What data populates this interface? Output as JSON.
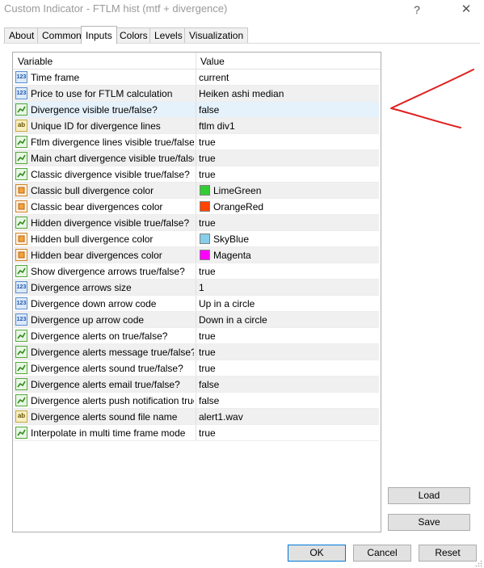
{
  "window": {
    "title": "Custom Indicator - FTLM hist (mtf + divergence)",
    "help_glyph": "?",
    "close_glyph": "✕"
  },
  "tabs": [
    {
      "label": "About"
    },
    {
      "label": "Common"
    },
    {
      "label": "Inputs",
      "active": true
    },
    {
      "label": "Colors"
    },
    {
      "label": "Levels"
    },
    {
      "label": "Visualization"
    }
  ],
  "grid": {
    "col_variable": "Variable",
    "col_value": "Value",
    "rows": [
      {
        "type": "int",
        "name": "Time frame",
        "value": "current"
      },
      {
        "type": "int",
        "name": "Price to use for FTLM calculation",
        "value": "Heiken ashi median"
      },
      {
        "type": "bool",
        "name": "Divergence visible true/false?",
        "value": "false",
        "selected": true
      },
      {
        "type": "string",
        "name": "Unique ID for divergence lines",
        "value": "ftlm div1"
      },
      {
        "type": "bool",
        "name": "Ftlm divergence lines visible true/false?",
        "value": "true"
      },
      {
        "type": "bool",
        "name": "Main chart divergence visible true/false?",
        "value": "true"
      },
      {
        "type": "bool",
        "name": "Classic divergence visible true/false?",
        "value": "true"
      },
      {
        "type": "color",
        "name": "Classic bull divergence color",
        "value": "LimeGreen",
        "color": "#32cd32"
      },
      {
        "type": "color",
        "name": "Classic bear divergences color",
        "value": "OrangeRed",
        "color": "#ff4500"
      },
      {
        "type": "bool",
        "name": "Hidden divergence visible true/false?",
        "value": "true"
      },
      {
        "type": "color",
        "name": "Hidden bull divergence color",
        "value": "SkyBlue",
        "color": "#87ceeb"
      },
      {
        "type": "color",
        "name": "Hidden bear divergences color",
        "value": "Magenta",
        "color": "#ff00ff"
      },
      {
        "type": "bool",
        "name": "Show divergence arrows true/false?",
        "value": "true"
      },
      {
        "type": "int",
        "name": "Divergence arrows size",
        "value": "1"
      },
      {
        "type": "int",
        "name": "Divergence down arrow code",
        "value": "Up in a circle"
      },
      {
        "type": "int",
        "name": "Divergence up arrow code",
        "value": "Down in a circle"
      },
      {
        "type": "bool",
        "name": "Divergence alerts on true/false?",
        "value": "true"
      },
      {
        "type": "bool",
        "name": "Divergence alerts message true/false?",
        "value": "true"
      },
      {
        "type": "bool",
        "name": "Divergence alerts sound true/false?",
        "value": "true"
      },
      {
        "type": "bool",
        "name": "Divergence alerts email true/false?",
        "value": "false"
      },
      {
        "type": "bool",
        "name": "Divergence alerts push notification true/f...",
        "value": "false"
      },
      {
        "type": "string",
        "name": "Divergence alerts sound file name",
        "value": "alert1.wav"
      },
      {
        "type": "bool",
        "name": "Interpolate in multi time frame mode",
        "value": "true"
      }
    ]
  },
  "icon_labels": {
    "int": "123",
    "string": "ab"
  },
  "buttons": {
    "load": "Load",
    "save": "Save",
    "ok": "OK",
    "cancel": "Cancel",
    "reset": "Reset"
  },
  "annotation": {
    "color": "#e02020"
  }
}
